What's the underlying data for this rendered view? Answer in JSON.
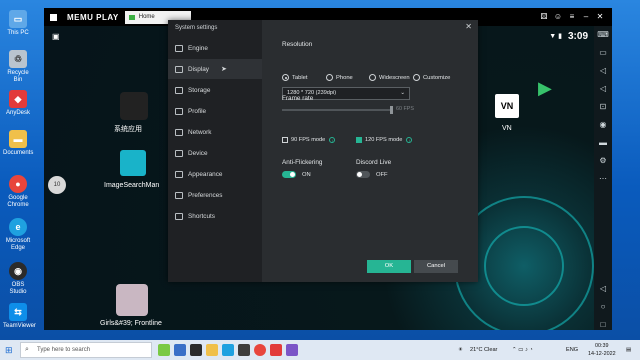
{
  "desktop": {
    "icons": [
      {
        "label": "This PC",
        "color": "#5fa8e8"
      },
      {
        "label": "Recycle Bin",
        "color": "#b9c4cf"
      },
      {
        "label": "AnyDesk",
        "color": "#e23b3b"
      },
      {
        "label": "Documents",
        "color": "#f0c04a"
      },
      {
        "label": "Google Chrome",
        "color": "#e8453c"
      },
      {
        "label": "Microsoft Edge",
        "color": "#1fa1e0"
      },
      {
        "label": "OBS Studio",
        "color": "#2b2b2b"
      },
      {
        "label": "TeamViewer",
        "color": "#0e8ee9"
      }
    ]
  },
  "memu": {
    "logo": "MEMU PLAY",
    "tab_label": "Home",
    "clock": "3:09",
    "apps": [
      {
        "label": "系统应用"
      },
      {
        "label": "ImageSearchMan"
      },
      {
        "label": "Girls&#39; Frontline"
      },
      {
        "label": "VN"
      }
    ],
    "badge_10": "10"
  },
  "dialog": {
    "title": "System settings",
    "menu": [
      "Engine",
      "Display",
      "Storage",
      "Profile",
      "Network",
      "Device",
      "Appearance",
      "Preferences",
      "Shortcuts"
    ],
    "active_item": "Display",
    "resolution": {
      "label": "Resolution",
      "options": [
        "Tablet",
        "Phone",
        "Widescreen",
        "Customize"
      ],
      "selected": "Tablet",
      "value": "1280 * 720 (239dpi)"
    },
    "frame_rate": {
      "label": "Frame rate",
      "value_label": "60 FPS",
      "fps90": "90 FPS mode",
      "fps120": "120 FPS mode"
    },
    "anti_flicker": {
      "label": "Anti-Flickering",
      "state": "ON"
    },
    "discord": {
      "label": "Discord Live",
      "state": "OFF"
    },
    "ok": "OK",
    "cancel": "Cancel"
  },
  "taskbar": {
    "search_placeholder": "Type here to search",
    "weather": "21°C  Clear",
    "lang": "ENG",
    "time": "00:39",
    "date": "14-12-2022"
  },
  "colors": {
    "accent": "#26b594",
    "dialog_bg": "#2a2d30",
    "taskbar": "#dfe8f3"
  }
}
